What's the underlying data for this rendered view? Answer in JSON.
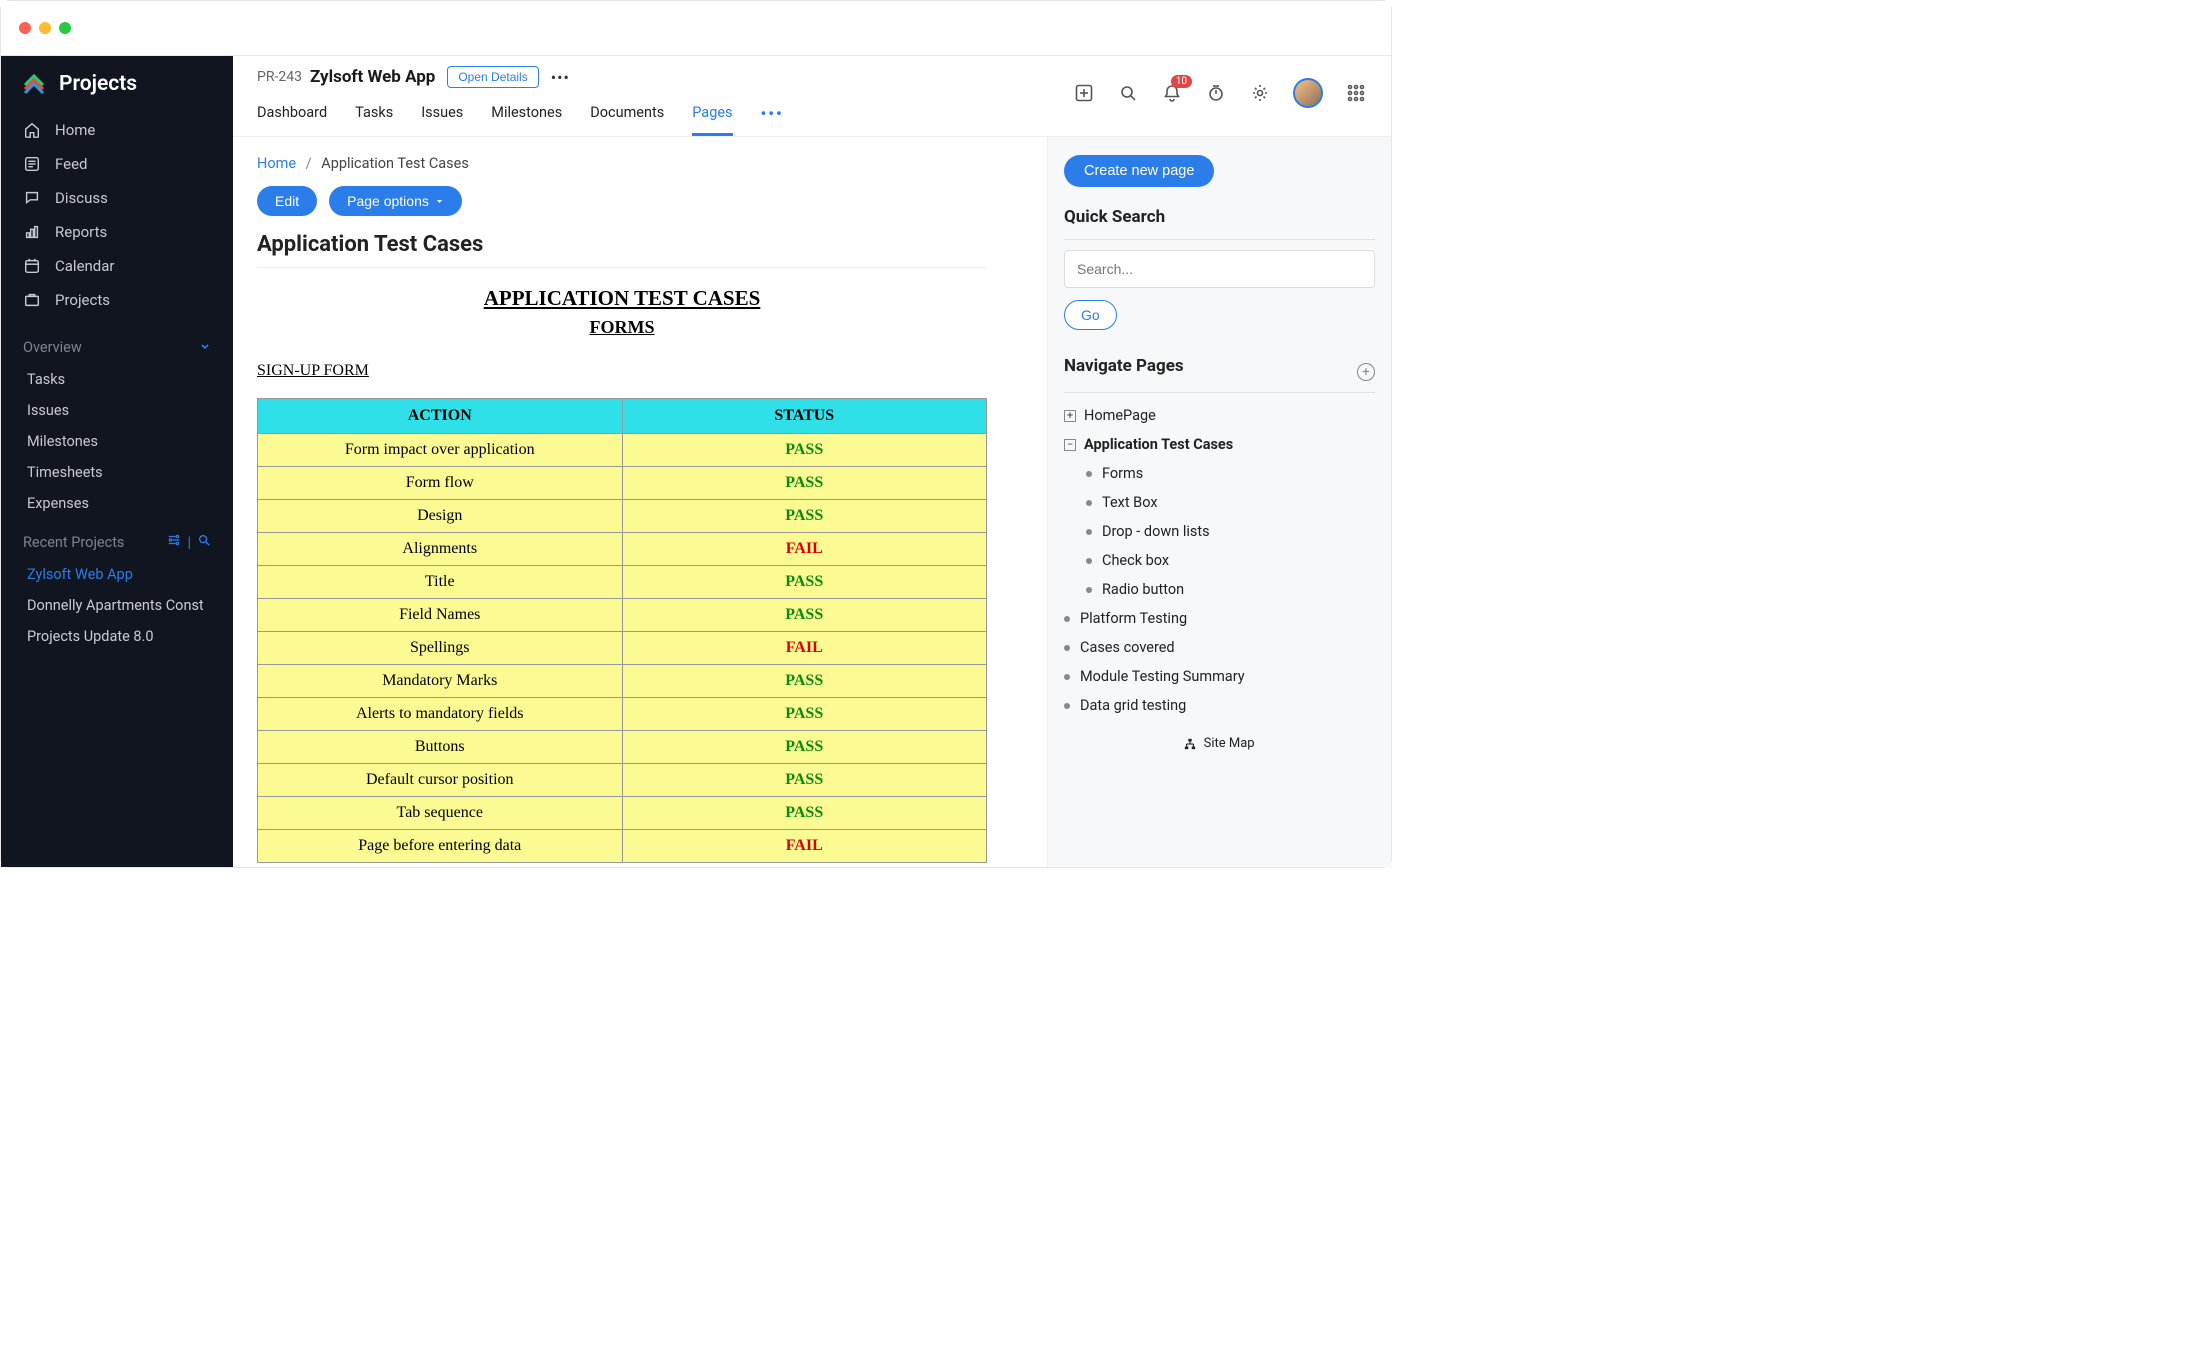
{
  "app": {
    "brand": "Projects"
  },
  "sidebar": {
    "nav": [
      {
        "label": "Home"
      },
      {
        "label": "Feed"
      },
      {
        "label": "Discuss"
      },
      {
        "label": "Reports"
      },
      {
        "label": "Calendar"
      },
      {
        "label": "Projects"
      }
    ],
    "overview_label": "Overview",
    "subnav": [
      {
        "label": "Tasks"
      },
      {
        "label": "Issues"
      },
      {
        "label": "Milestones"
      },
      {
        "label": "Timesheets"
      },
      {
        "label": "Expenses"
      }
    ],
    "recent_label": "Recent Projects",
    "recent": [
      {
        "label": "Zylsoft Web App",
        "active": true
      },
      {
        "label": "Donnelly Apartments Const",
        "active": false
      },
      {
        "label": "Projects Update 8.0",
        "active": false
      }
    ]
  },
  "header": {
    "project_code": "PR-243",
    "project_name": "Zylsoft Web App",
    "open_details": "Open Details",
    "tabs": [
      {
        "label": "Dashboard",
        "active": false
      },
      {
        "label": "Tasks",
        "active": false
      },
      {
        "label": "Issues",
        "active": false
      },
      {
        "label": "Milestones",
        "active": false
      },
      {
        "label": "Documents",
        "active": false
      },
      {
        "label": "Pages",
        "active": true
      }
    ],
    "badge_count": "10"
  },
  "content": {
    "breadcrumb_home": "Home",
    "breadcrumb_current": "Application Test Cases",
    "edit_btn": "Edit",
    "page_options_btn": "Page options",
    "page_title": "Application Test Cases",
    "doc": {
      "title": "APPLICATION TEST CASES",
      "subtitle": "FORMS",
      "section": "SIGN-UP FORM",
      "col_action": "ACTION",
      "col_status": "STATUS",
      "rows": [
        {
          "action": "Form impact over application",
          "status": "PASS"
        },
        {
          "action": "Form flow",
          "status": "PASS"
        },
        {
          "action": "Design",
          "status": "PASS"
        },
        {
          "action": "Alignments",
          "status": "FAIL"
        },
        {
          "action": "Title",
          "status": "PASS"
        },
        {
          "action": "Field Names",
          "status": "PASS"
        },
        {
          "action": "Spellings",
          "status": "FAIL"
        },
        {
          "action": "Mandatory Marks",
          "status": "PASS"
        },
        {
          "action": "Alerts to mandatory fields",
          "status": "PASS"
        },
        {
          "action": "Buttons",
          "status": "PASS"
        },
        {
          "action": "Default cursor position",
          "status": "PASS"
        },
        {
          "action": "Tab sequence",
          "status": "PASS"
        },
        {
          "action": "Page before entering data",
          "status": "FAIL"
        }
      ]
    }
  },
  "rpanel": {
    "create_btn": "Create new page",
    "quick_search_h": "Quick Search",
    "search_placeholder": "Search...",
    "go_btn": "Go",
    "nav_pages_h": "Navigate Pages",
    "tree": {
      "homepage": "HomePage",
      "current": "Application Test Cases",
      "children": [
        "Forms",
        "Text Box",
        "Drop - down lists",
        "Check box",
        "Radio button"
      ],
      "siblings": [
        "Platform Testing",
        "Cases covered",
        "Module Testing Summary",
        "Data grid testing"
      ]
    },
    "sitemap_label": "Site Map"
  }
}
